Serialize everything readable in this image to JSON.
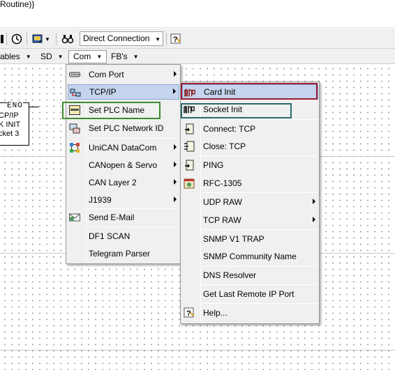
{
  "window": {
    "title_fragment": "Routine)}"
  },
  "toolbar": {
    "connection_value": "Direct Connection"
  },
  "menubar": {
    "items": [
      {
        "label": "ables"
      },
      {
        "label": "SD"
      },
      {
        "label": "Com"
      },
      {
        "label": "FB's"
      }
    ]
  },
  "canvas": {
    "fb_en": "ENO",
    "fb_lines": [
      "CP/IP",
      "K INIT",
      "cket 3"
    ]
  },
  "com_menu": {
    "items": [
      {
        "label": "Com Port",
        "icon": "serial-port-icon",
        "submenu": true
      },
      {
        "label": "TCP/IP",
        "icon": "network-icon",
        "submenu": true,
        "highlighted": true
      },
      {
        "label": "Set PLC Name",
        "icon": "plc-name-icon",
        "submenu": false
      },
      {
        "label": "Set PLC Network ID",
        "icon": "network-id-icon",
        "submenu": false
      },
      {
        "label": "UniCAN DataCom",
        "icon": "unican-icon",
        "submenu": true
      },
      {
        "label": "CANopen & Servo",
        "icon": "",
        "submenu": true
      },
      {
        "label": "CAN Layer 2",
        "icon": "",
        "submenu": true
      },
      {
        "label": "J1939",
        "icon": "",
        "submenu": true
      },
      {
        "label": "Send E-Mail",
        "icon": "email-icon",
        "submenu": false
      },
      {
        "label": "DF1 SCAN",
        "icon": "",
        "submenu": false
      },
      {
        "label": "Telegram Parser",
        "icon": "",
        "submenu": false
      }
    ]
  },
  "tcpip_menu": {
    "items": [
      {
        "label": "Card Init",
        "icon": "card-init-icon",
        "submenu": false,
        "highlighted": true
      },
      {
        "label": "Socket Init",
        "icon": "socket-init-icon",
        "submenu": false
      },
      {
        "label": "Connect: TCP",
        "icon": "connect-tcp-icon",
        "submenu": false
      },
      {
        "label": "Close: TCP",
        "icon": "close-tcp-icon",
        "submenu": false
      },
      {
        "label": "PING",
        "icon": "ping-icon",
        "submenu": false
      },
      {
        "label": "RFC-1305",
        "icon": "rfc-icon",
        "submenu": false
      },
      {
        "label": "UDP RAW",
        "icon": "",
        "submenu": true
      },
      {
        "label": "TCP RAW",
        "icon": "",
        "submenu": true
      },
      {
        "label": "SNMP V1 TRAP",
        "icon": "",
        "submenu": false
      },
      {
        "label": "SNMP Community Name",
        "icon": "",
        "submenu": false
      },
      {
        "label": "DNS Resolver",
        "icon": "",
        "submenu": false
      },
      {
        "label": "Get Last Remote IP Port",
        "icon": "",
        "submenu": false
      },
      {
        "label": "Help...",
        "icon": "help-icon",
        "submenu": false
      }
    ]
  },
  "colors": {
    "highlight_fill": "#c4d4ec",
    "annotation_red": "#9b1b30",
    "annotation_green": "#3c8a2e",
    "annotation_teal": "#2b6b6b"
  }
}
